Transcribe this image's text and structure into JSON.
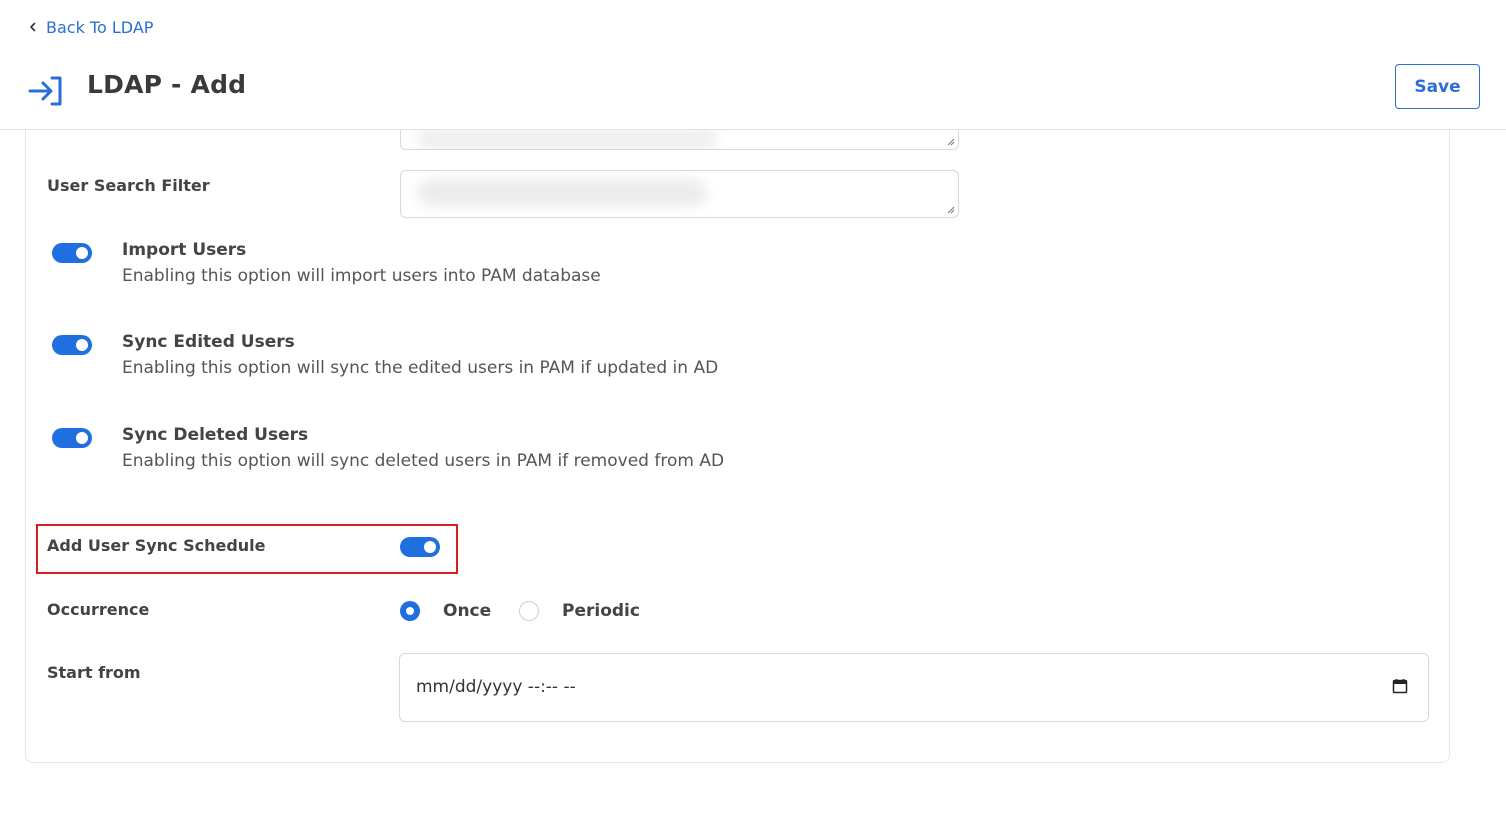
{
  "back_link": {
    "label": "Back To LDAP"
  },
  "header": {
    "title": "LDAP - Add",
    "save_label": "Save"
  },
  "fields": {
    "user_search_filter_label": "User Search Filter"
  },
  "sync_options": [
    {
      "title": "Import Users",
      "description": "Enabling this option will import users into PAM database",
      "enabled": true
    },
    {
      "title": "Sync Edited Users",
      "description": "Enabling this option will sync the edited users in PAM if updated in AD",
      "enabled": true
    },
    {
      "title": "Sync Deleted Users",
      "description": "Enabling this option will sync deleted users in PAM if removed from AD",
      "enabled": true
    }
  ],
  "schedule": {
    "label": "Add User Sync Schedule",
    "enabled": true,
    "occurrence_label": "Occurrence",
    "occurrence_options": [
      "Once",
      "Periodic"
    ],
    "occurrence_selected": "Once",
    "start_from_label": "Start from",
    "start_from_value": "mm/dd/yyyy --:-- --"
  },
  "colors": {
    "accent": "#1f6fe0",
    "link": "#2a6fd6",
    "highlight": "#d92020"
  },
  "icons": {
    "back": "chevron-left-icon",
    "title": "login-arrow-icon",
    "calendar": "calendar-icon"
  }
}
